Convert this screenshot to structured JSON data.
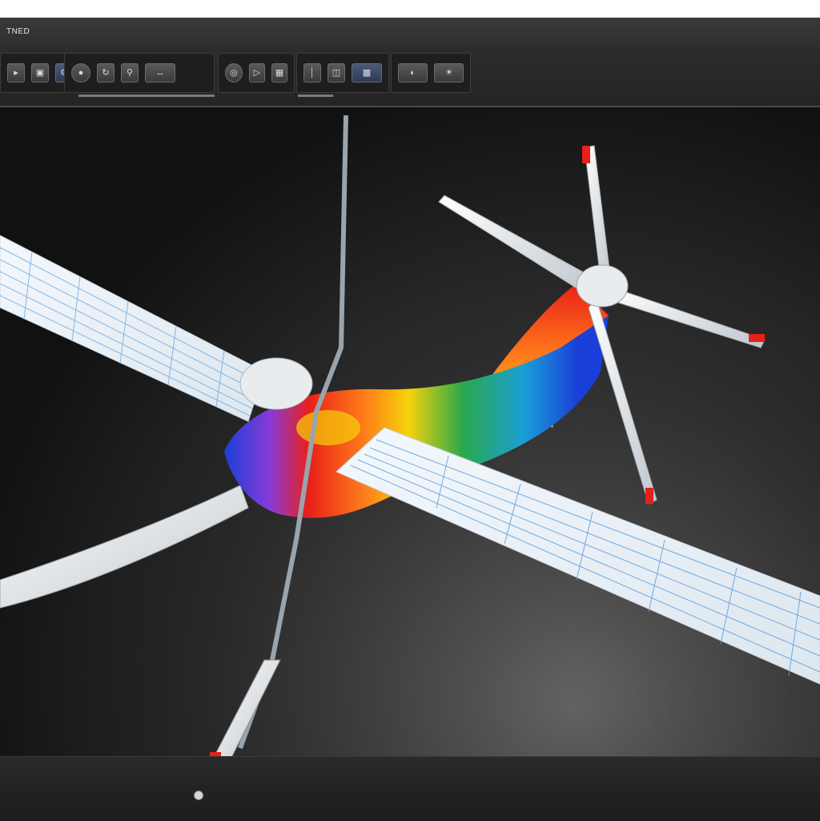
{
  "window": {
    "title": "TNED"
  },
  "toolbar": {
    "groups": [
      {
        "id": "file",
        "buttons": [
          "open-icon",
          "save-icon",
          "settings-icon"
        ]
      },
      {
        "id": "view",
        "buttons": [
          "sphere-icon",
          "rotate-icon",
          "zoom-icon",
          "pan-icon"
        ]
      },
      {
        "id": "mesh",
        "buttons": [
          "mesh-icon",
          "select-icon",
          "measure-icon",
          "probe-icon"
        ]
      },
      {
        "id": "analysis",
        "buttons": [
          "result-icon",
          "colormap-icon",
          "slice-icon"
        ]
      },
      {
        "id": "render",
        "buttons": [
          "shading-icon",
          "light-icon"
        ]
      }
    ]
  },
  "colors": {
    "accent": "#4a5a7a",
    "contour_hot": "#e8201a",
    "contour_mid": "#f5d20a",
    "contour_warm": "#ff7a1a",
    "contour_cool": "#2aa84a",
    "contour_cold": "#1a3fd8",
    "mesh_line": "#5a9fe0"
  }
}
